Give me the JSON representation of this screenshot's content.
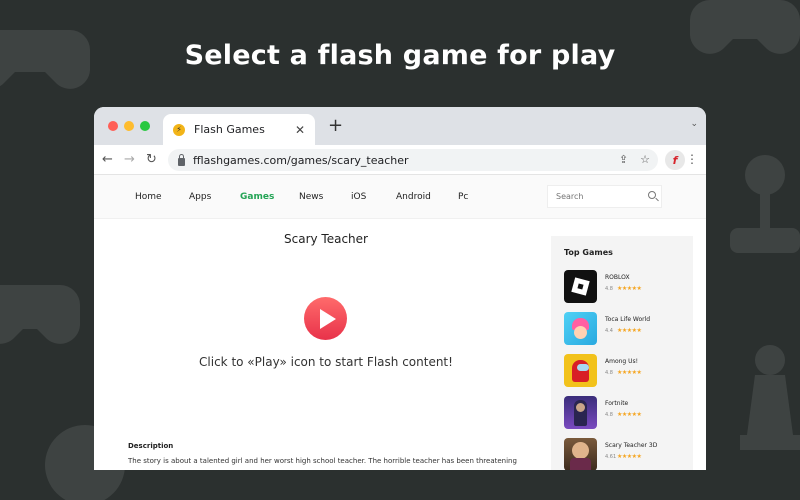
{
  "headline": "Select a flash game for play",
  "window_controls": {
    "close_color": "#ff5f57",
    "minimize_color": "#febc2e",
    "maximize_color": "#28c840"
  },
  "tab": {
    "title": "Flash Games",
    "close": "✕",
    "new_tab": "+"
  },
  "address_bar": {
    "url": "fflashgames.com/games/scary_teacher"
  },
  "site": {
    "nav": [
      "Home",
      "Apps",
      "Games",
      "News",
      "iOS",
      "Android",
      "Pc"
    ],
    "active_nav": "Games",
    "search_placeholder": "Search",
    "game_title": "Scary Teacher",
    "play_hint": "Click to «Play» icon to start Flash content!",
    "description_heading": "Description",
    "description_text": "The story is about a talented girl and her worst high school teacher. The horrible teacher has been threatening"
  },
  "sidebar": {
    "title": "Top Games",
    "games": [
      {
        "name": "ROBLOX",
        "rating": "4.8",
        "stars": "★★★★★"
      },
      {
        "name": "Toca Life World",
        "rating": "4.4",
        "stars": "★★★★★"
      },
      {
        "name": "Among Us!",
        "rating": "4.8",
        "stars": "★★★★★"
      },
      {
        "name": "Fortnite",
        "rating": "4.8",
        "stars": "★★★★★"
      },
      {
        "name": "Scary Teacher 3D",
        "rating": "4.61",
        "stars": "★★★★★"
      }
    ]
  },
  "colors": {
    "background": "#2b302f",
    "accent_green": "#23a455",
    "play_red": "#e8324a",
    "star": "#f5a623"
  }
}
